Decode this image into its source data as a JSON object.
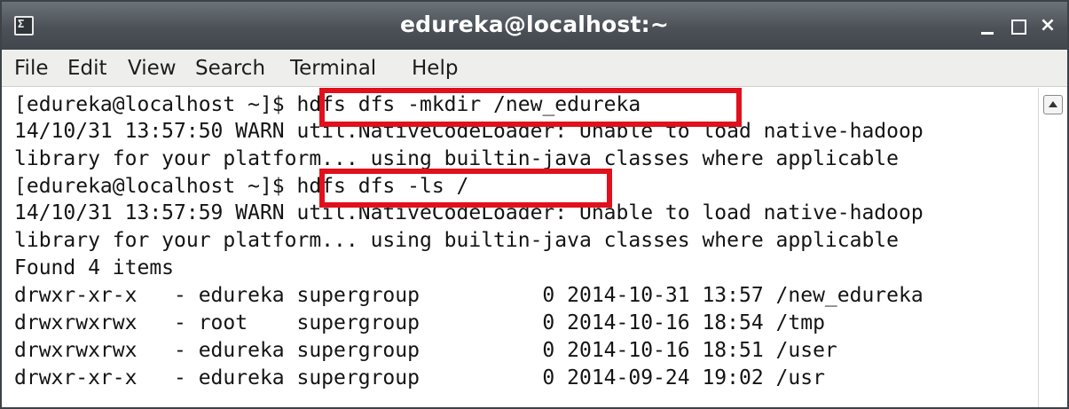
{
  "window": {
    "title": "edureka@localhost:~",
    "app_icon": "terminal-icon",
    "app_icon_glyph": "Σ",
    "controls": {
      "minimize": "minimize-icon",
      "maximize": "maximize-icon",
      "close": "×"
    }
  },
  "menubar": {
    "items": [
      "File",
      "Edit",
      "View",
      "Search",
      "Terminal",
      "Help"
    ]
  },
  "terminal": {
    "lines": [
      {
        "prompt": "[edureka@localhost ~]$ ",
        "command": "hdfs dfs -mkdir /new_edureka"
      },
      {
        "text": "14/10/31 13:57:50 WARN util.NativeCodeLoader: Unable to load native-hadoop"
      },
      {
        "text": "library for your platform... using builtin-java classes where applicable"
      },
      {
        "prompt": "[edureka@localhost ~]$ ",
        "command": "hdfs dfs -ls /"
      },
      {
        "text": "14/10/31 13:57:59 WARN util.NativeCodeLoader: Unable to load native-hadoop"
      },
      {
        "text": "library for your platform... using builtin-java classes where applicable"
      },
      {
        "text": "Found 4 items"
      },
      {
        "text": "drwxr-xr-x   - edureka supergroup          0 2014-10-31 13:57 /new_edureka"
      },
      {
        "text": "drwxrwxrwx   - root    supergroup          0 2014-10-16 18:54 /tmp"
      },
      {
        "text": "drwxrwxrwx   - edureka supergroup          0 2014-10-16 18:51 /user"
      },
      {
        "text": "drwxr-xr-x   - edureka supergroup          0 2014-09-24 19:02 /usr"
      }
    ]
  },
  "colors": {
    "highlight": "#e0101c",
    "titlebar": "#4b5157",
    "menubar": "#eeeeec",
    "text": "#141414"
  }
}
